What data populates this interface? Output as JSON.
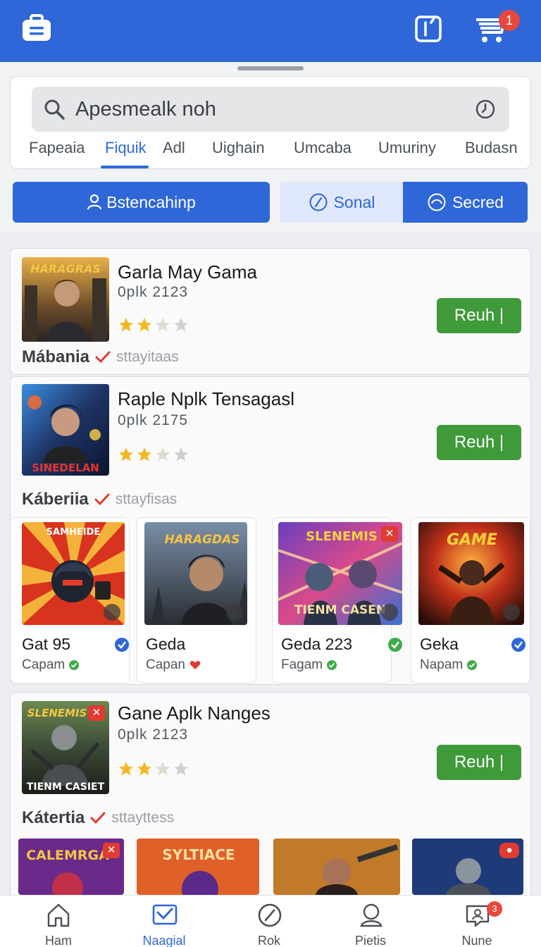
{
  "header": {
    "cart_badge": "1",
    "icons": [
      "briefcase-icon",
      "share-icon",
      "cart-icon"
    ]
  },
  "search": {
    "placeholder": "Apesmealk noh"
  },
  "category_tabs": [
    "Fapeaia",
    "Fiquik",
    "Adl",
    "Uighain",
    "Umcaba",
    "Umuriny",
    "Budasn"
  ],
  "category_active": "Fiquik",
  "filters": {
    "primary": "Bstencahinp",
    "secondary": "Sonal",
    "tertiary": "Secred"
  },
  "games": [
    {
      "title": "Garla May Gama",
      "sub": "0plk 2123",
      "rating": 2,
      "button": "Reuh",
      "category": "Mábania",
      "status": "sttayitaas"
    },
    {
      "title": "Raple Nplk Tensagasl",
      "sub": "0plk 2175",
      "rating": 2,
      "button": "Reuh",
      "category": "Káberiia",
      "status": "sttayfisas",
      "thumb_text": "SINEDELAN"
    },
    {
      "title": "Gane Aplk Nanges",
      "sub": "0plk 2123",
      "rating": 2,
      "button": "Reuh",
      "category": "Kátertia",
      "status": "sttayttess"
    }
  ],
  "mini_cards": [
    {
      "title": "Gat 95",
      "sub": "Capam",
      "sub_mark": "ok",
      "verified": true
    },
    {
      "title": "Geda",
      "sub": "Capan",
      "sub_mark": "heart",
      "verified": false
    },
    {
      "title": "Geda 223",
      "sub": "Fagam",
      "sub_mark": "ok",
      "verified": true
    },
    {
      "title": "Geka",
      "sub": "Napam",
      "sub_mark": "ok",
      "verified": true
    }
  ],
  "bottom_nav": [
    {
      "label": "Ham",
      "icon": "home-icon"
    },
    {
      "label": "Naagial",
      "icon": "mail-icon",
      "active": true
    },
    {
      "label": "Rok",
      "icon": "compass-icon"
    },
    {
      "label": "Pietis",
      "icon": "profile-icon"
    },
    {
      "label": "Nune",
      "icon": "chat-icon",
      "badge": "3"
    }
  ],
  "colors": {
    "primary": "#2f67d8",
    "success": "#3f9a3a",
    "badge": "#e8473c",
    "star": "#f2b824"
  }
}
